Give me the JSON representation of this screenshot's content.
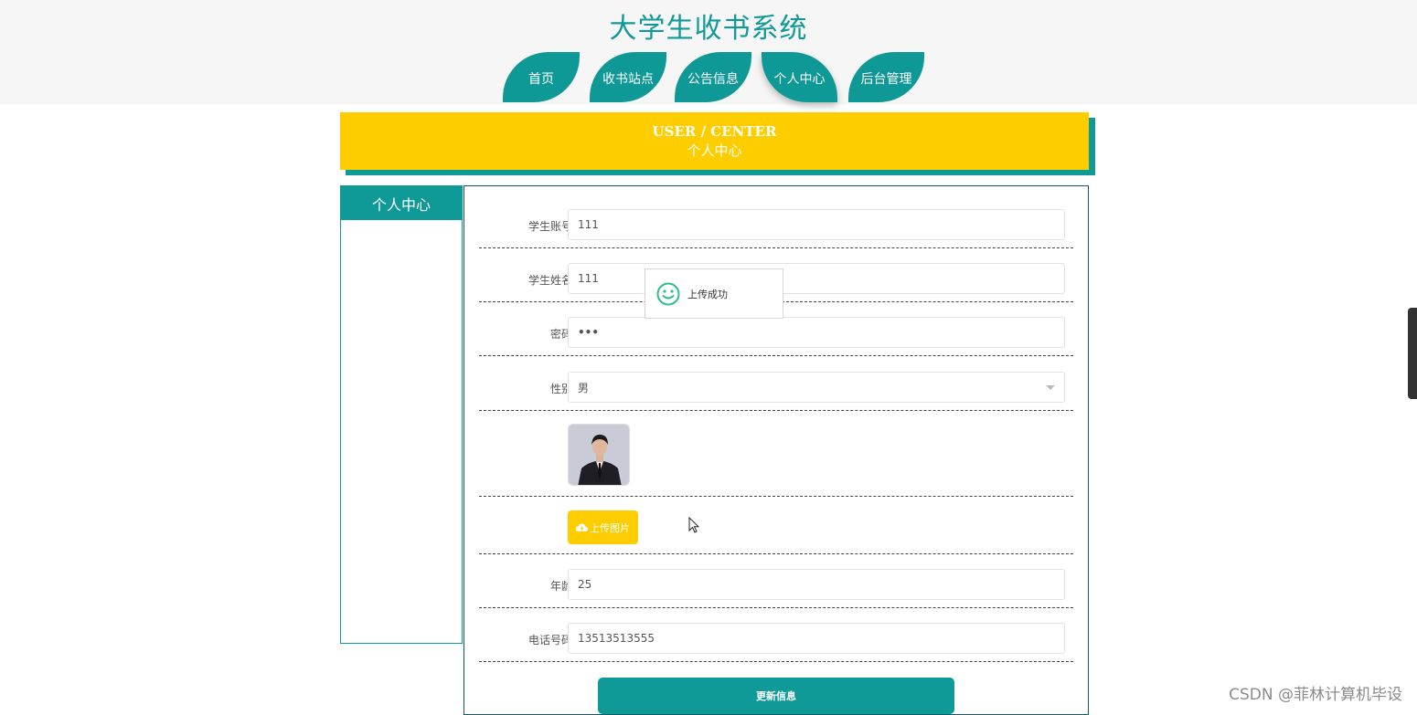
{
  "header": {
    "site_title": "大学生收书系统",
    "nav": [
      {
        "label": "首页"
      },
      {
        "label": "收书站点"
      },
      {
        "label": "公告信息"
      },
      {
        "label": "个人中心",
        "active": true
      },
      {
        "label": "后台管理"
      }
    ]
  },
  "banner": {
    "en": "USER / CENTER",
    "cn": "个人中心"
  },
  "sidebar": {
    "title": "个人中心"
  },
  "form": {
    "fields": {
      "account": {
        "label": "学生账号",
        "value": "111"
      },
      "name": {
        "label": "学生姓名",
        "value": "111"
      },
      "password": {
        "label": "密码",
        "value": "•••"
      },
      "gender": {
        "label": "性别",
        "value": "男"
      },
      "age": {
        "label": "年龄",
        "value": "25"
      },
      "phone": {
        "label": "电话号码",
        "value": "13513513555"
      }
    },
    "upload_label": "上传图片",
    "submit_label": "更新信息"
  },
  "toast": {
    "message": "上传成功"
  },
  "watermark": "CSDN @菲林计算机毕设",
  "colors": {
    "teal": "#109a97",
    "yellow": "#fecd00"
  }
}
